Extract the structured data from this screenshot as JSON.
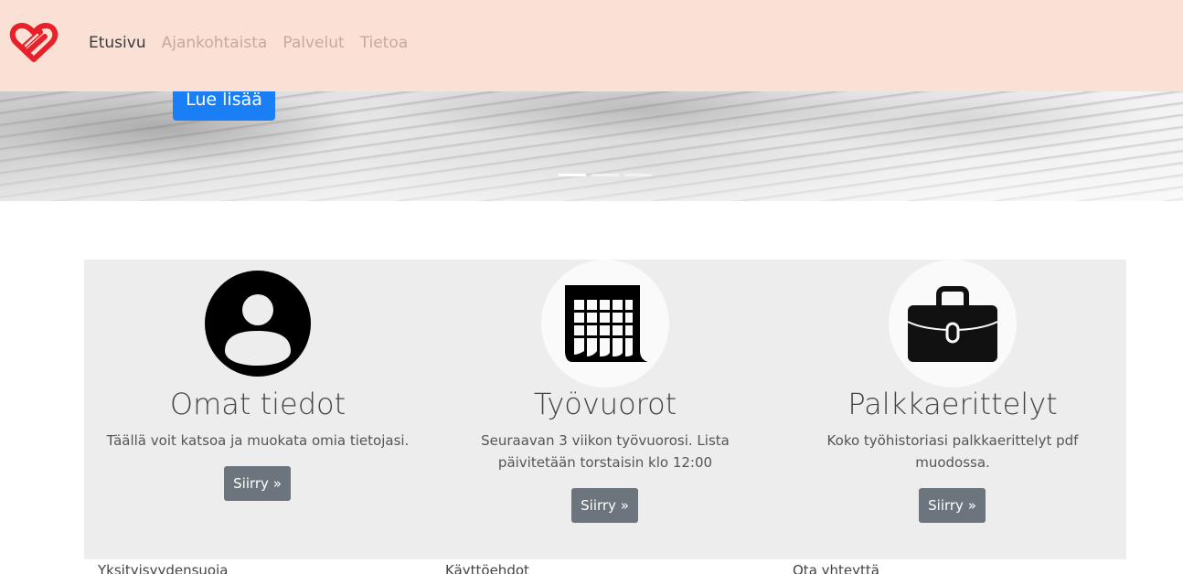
{
  "nav": {
    "links": [
      {
        "label": "Etusivu",
        "active": true
      },
      {
        "label": "Ajankohtaista",
        "active": false
      },
      {
        "label": "Palvelut",
        "active": false
      },
      {
        "label": "Tietoa",
        "active": false
      }
    ],
    "logo_icon": "heart-link-logo",
    "bg_color": "#fbe0d6"
  },
  "hero": {
    "button_label": "Lue lisää",
    "button_color": "#1a7ff5",
    "slides_count": 3,
    "active_slide": 1
  },
  "features": [
    {
      "icon": "user-circle-icon",
      "title": "Omat tiedot",
      "text": "Täällä voit katsoa ja muokata omia tietojasi.",
      "button": "Siirry »"
    },
    {
      "icon": "calendar-icon",
      "title": "Työvuorot",
      "text": "Seuraavan 3 viikon työvuorosi. Lista päivitetään torstaisin klo 12:00",
      "button": "Siirry »"
    },
    {
      "icon": "briefcase-icon",
      "title": "Palkkaerittelyt",
      "text": "Koko työhistoriasi palkkaerittelyt pdf muodossa.",
      "button": "Siirry »"
    }
  ],
  "footer": {
    "links": [
      "Yksityisyydensuoja",
      "Käyttöehdot",
      "Ota yhteyttä"
    ]
  }
}
